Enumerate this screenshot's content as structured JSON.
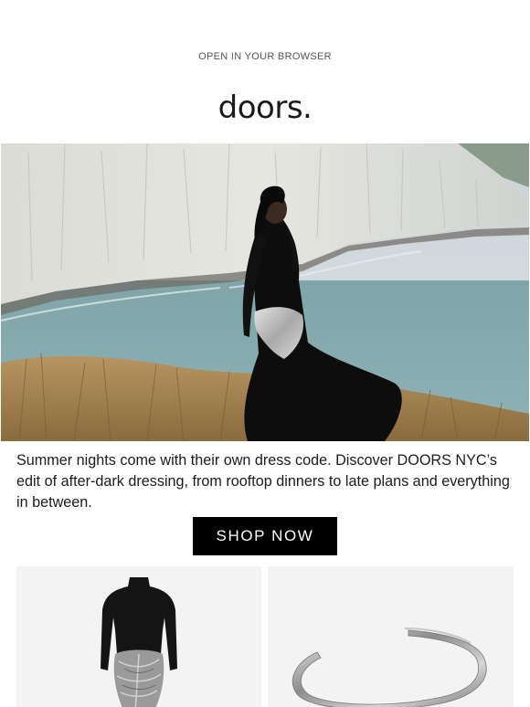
{
  "header": {
    "browser_link": "OPEN IN YOUR BROWSER",
    "logo": "doors."
  },
  "hero": {
    "image": "model-on-white-cliffs-photo"
  },
  "body": {
    "copy": "Summer nights come with their own dress code. Discover DOORS NYC’s edit of after-dark dressing, from rooftop dinners to late plans and everything in between.",
    "cta_label": "SHOP NOW"
  },
  "products": [
    {
      "image": "black-long-sleeve-dress-with-silver-drape"
    },
    {
      "image": "silver-cuff-bracelet"
    }
  ],
  "colors": {
    "cta_background": "#000000",
    "cta_text": "#ffffff",
    "product_background": "#f3f3f3"
  }
}
